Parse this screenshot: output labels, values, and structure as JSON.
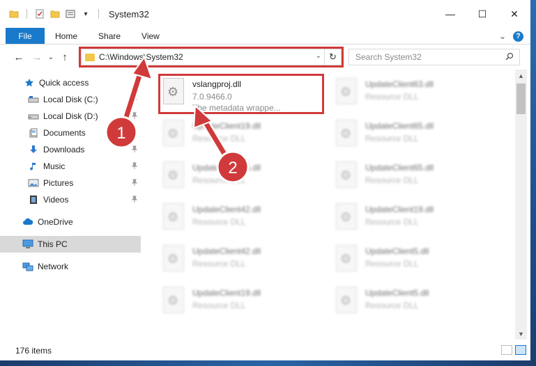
{
  "window": {
    "title": "System32",
    "controls": {
      "minimize": "—",
      "maximize": "☐",
      "close": "✕"
    }
  },
  "ribbon": {
    "tabs": [
      "File",
      "Home",
      "Share",
      "View"
    ],
    "collapse_glyph": "⌄",
    "help_glyph": "?"
  },
  "nav": {
    "back_glyph": "←",
    "forward_glyph": "→",
    "recent_glyph": "⌄",
    "up_glyph": "↑",
    "address": "C:\\Windows\\System32",
    "address_drop_glyph": "⌄",
    "refresh_glyph": "↻",
    "search_placeholder": "Search System32",
    "search_glyph": "⚲"
  },
  "sidebar": {
    "items": [
      {
        "label": "Quick access",
        "icon": "star-icon",
        "color": "#1979ca"
      },
      {
        "label": "Local Disk (C:)",
        "icon": "drive-icon",
        "pinned": true
      },
      {
        "label": "Local Disk (D:)",
        "icon": "drive-icon",
        "pinned": true
      },
      {
        "label": "Documents",
        "icon": "documents-icon",
        "pinned": true
      },
      {
        "label": "Downloads",
        "icon": "downloads-icon",
        "pinned": true
      },
      {
        "label": "Music",
        "icon": "music-icon",
        "pinned": true
      },
      {
        "label": "Pictures",
        "icon": "pictures-icon",
        "pinned": true
      },
      {
        "label": "Videos",
        "icon": "videos-icon",
        "pinned": true
      },
      {
        "label": "OneDrive",
        "icon": "cloud-icon"
      },
      {
        "label": "This PC",
        "icon": "computer-icon",
        "selected": true
      },
      {
        "label": "Network",
        "icon": "network-icon"
      }
    ],
    "pin_glyph": "📌"
  },
  "files": {
    "highlighted": {
      "name": "vslangproj.dll",
      "version": "7.0.9466.0",
      "description": "The metadata wrappe..."
    },
    "left_column": [
      {
        "name": "UpdateClient19.dll",
        "type": "Resource DLL"
      },
      {
        "name": "UpdateClient65.dll",
        "type": "Resource DLL"
      },
      {
        "name": "UpdateClient42.dll",
        "type": "Resource DLL"
      },
      {
        "name": "UpdateClient42.dll",
        "type": "Resource DLL"
      },
      {
        "name": "UpdateClient19.dll",
        "type": "Resource DLL"
      }
    ],
    "right_column": [
      {
        "name": "UpdateClient63.dll",
        "type": "Resource DLL"
      },
      {
        "name": "UpdateClient65.dll",
        "type": "Resource DLL"
      },
      {
        "name": "UpdateClient65.dll",
        "type": "Resource DLL"
      },
      {
        "name": "UpdateClient19.dll",
        "type": "Resource DLL"
      },
      {
        "name": "UpdateClient5.dll",
        "type": "Resource DLL"
      },
      {
        "name": "UpdateClient5.dll",
        "type": "Resource DLL"
      }
    ]
  },
  "status": {
    "count": "176 items"
  },
  "annotations": {
    "step1": "1",
    "step2": "2",
    "color": "#d03a3a"
  }
}
